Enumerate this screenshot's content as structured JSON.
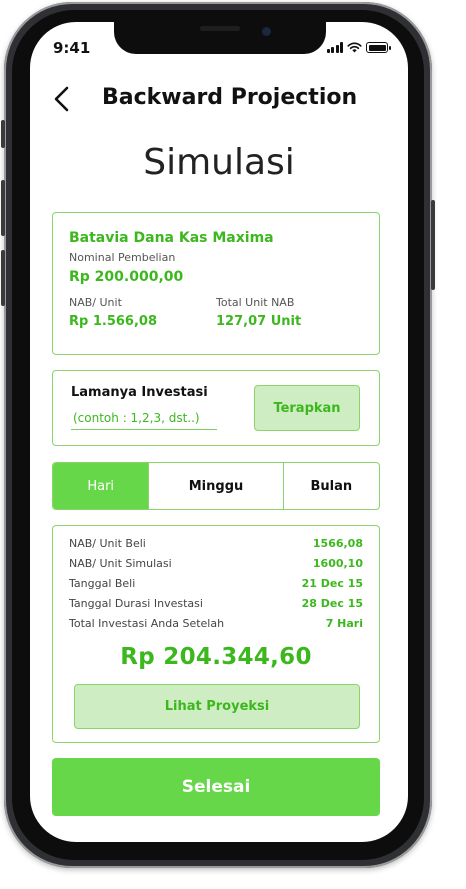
{
  "status_bar": {
    "time": "9:41"
  },
  "header": {
    "title": "Backward Projection",
    "back_icon": "chevron-left-icon"
  },
  "page": {
    "heading": "Simulasi"
  },
  "fund": {
    "name": "Batavia Dana Kas Maxima",
    "nominal_label": "Nominal Pembelian",
    "nominal_value": "Rp 200.000,00",
    "nab_label": "NAB/ Unit",
    "nab_value": "Rp 1.566,08",
    "total_unit_label": "Total Unit NAB",
    "total_unit_value": "127,07 Unit"
  },
  "investment": {
    "label": "Lamanya Investasi",
    "placeholder": "(contoh : 1,2,3, dst..)",
    "apply_label": "Terapkan"
  },
  "period_tabs": [
    {
      "label": "Hari",
      "active": true
    },
    {
      "label": "Minggu",
      "active": false
    },
    {
      "label": "Bulan",
      "active": false
    }
  ],
  "results": {
    "rows": [
      {
        "label": "NAB/ Unit Beli",
        "value": "1566,08"
      },
      {
        "label": "NAB/ Unit Simulasi",
        "value": "1600,10"
      },
      {
        "label": "Tanggal Beli",
        "value": "21 Dec 15"
      },
      {
        "label": "Tanggal Durasi Investasi",
        "value": "28 Dec 15"
      },
      {
        "label": "Total Investasi Anda Setelah",
        "value": "7 Hari"
      }
    ],
    "total_amount": "Rp 204.344,60",
    "projection_button": "Lihat Proyeksi"
  },
  "footer": {
    "done_label": "Selesai"
  },
  "colors": {
    "accent": "#66d748",
    "accent_text": "#3cb81e",
    "accent_light": "#cfedc2",
    "border": "#8ad46a"
  }
}
